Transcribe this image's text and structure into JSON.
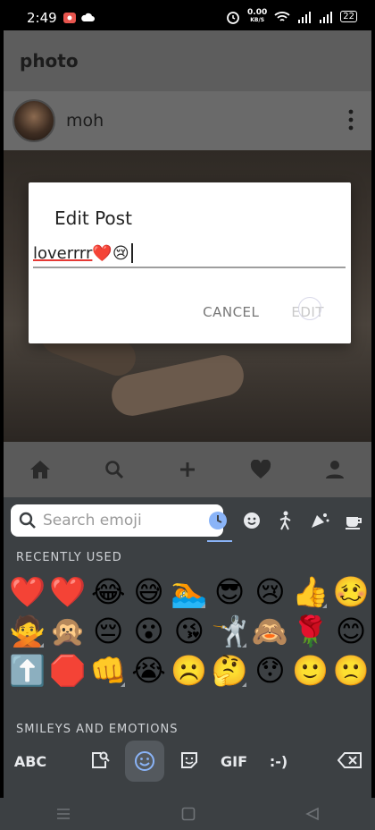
{
  "status_bar": {
    "time": "2:49",
    "net_speed": "0.00",
    "net_unit": "KB/S",
    "battery": "22"
  },
  "app": {
    "title": "photo",
    "post_user": "moh",
    "nav_icons": [
      "home-icon",
      "search-icon",
      "add-icon",
      "favorite-icon",
      "person-icon"
    ]
  },
  "dialog": {
    "title": "Edit Post",
    "input_text": "loverrrr",
    "input_emojis": "❤️😢",
    "cancel_label": "CANCEL",
    "edit_label": "EDIT"
  },
  "keyboard": {
    "search_placeholder": "Search emoji",
    "recently_used_label": "RECENTLY USED",
    "smileys_label": "SMILEYS AND EMOTIONS",
    "emojis": [
      "❤️",
      "❤️",
      "😂",
      "😅",
      "🏊",
      "😎",
      "😢",
      "👍",
      "🥴",
      "🙅",
      "🙊",
      "😔",
      "😮",
      "😘",
      "🤺",
      "🙈",
      "🌹",
      "😊",
      "⬆️",
      "🛑",
      "👊",
      "😭",
      "☹️",
      "🤔",
      "😯",
      "🙂",
      "🙁"
    ],
    "abc_label": "ABC",
    "gif_label": "GIF",
    "emoticon_label": ":-)",
    "accent_color": "#8ab4f8"
  }
}
